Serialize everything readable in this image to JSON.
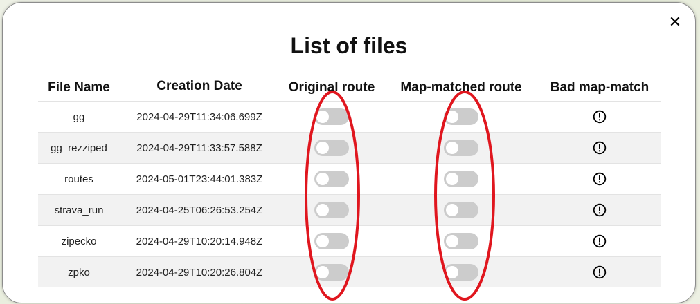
{
  "modal": {
    "title": "List of files",
    "close_glyph": "✕"
  },
  "table": {
    "headers": [
      "File Name",
      "Creation Date",
      "Original route",
      "Map-matched route",
      "Bad map-match"
    ],
    "rows": [
      {
        "file_name": "gg",
        "creation_date": "2024-04-29T11:34:06.699Z",
        "original_route": false,
        "map_matched_route": false
      },
      {
        "file_name": "gg_rezziped",
        "creation_date": "2024-04-29T11:33:57.588Z",
        "original_route": false,
        "map_matched_route": false
      },
      {
        "file_name": "routes",
        "creation_date": "2024-05-01T23:44:01.383Z",
        "original_route": false,
        "map_matched_route": false
      },
      {
        "file_name": "strava_run",
        "creation_date": "2024-04-25T06:26:53.254Z",
        "original_route": false,
        "map_matched_route": false
      },
      {
        "file_name": "zipecko",
        "creation_date": "2024-04-29T10:20:14.948Z",
        "original_route": false,
        "map_matched_route": false
      },
      {
        "file_name": "zpko",
        "creation_date": "2024-04-29T10:20:26.804Z",
        "original_route": false,
        "map_matched_route": false
      }
    ]
  },
  "icons": {
    "close": "close-icon",
    "bad_map_match": "exclamation-circle-icon"
  },
  "colors": {
    "annotation": "#e0161e",
    "toggle_off": "#cccccc",
    "row_alt": "#f2f2f2"
  }
}
